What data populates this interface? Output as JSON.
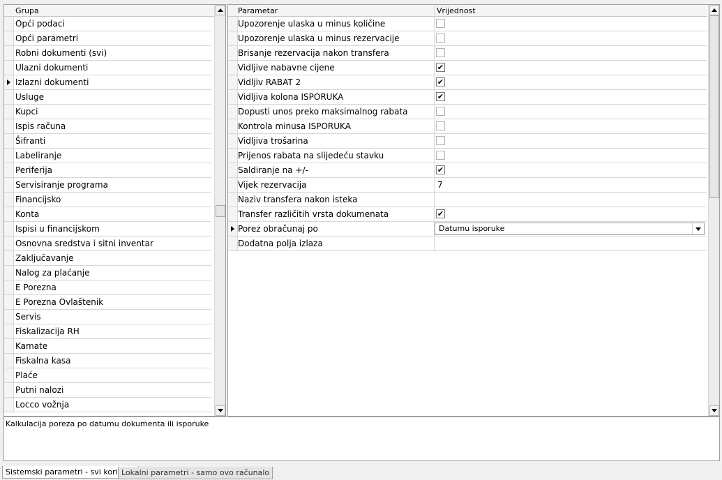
{
  "groups": {
    "header": "Grupa",
    "items": [
      {
        "label": "Opći podaci"
      },
      {
        "label": "Opći parametri"
      },
      {
        "label": "Robni dokumenti (svi)"
      },
      {
        "label": "Ulazni dokumenti"
      },
      {
        "label": "Izlazni dokumenti",
        "selected": true
      },
      {
        "label": "Usluge"
      },
      {
        "label": "Kupci"
      },
      {
        "label": "Ispis računa"
      },
      {
        "label": "Šifranti"
      },
      {
        "label": "Labeliranje"
      },
      {
        "label": "Periferija"
      },
      {
        "label": "Servisiranje programa"
      },
      {
        "label": "Financijsko"
      },
      {
        "label": "Konta"
      },
      {
        "label": "Ispisi u financijskom"
      },
      {
        "label": "Osnovna sredstva i sitni inventar"
      },
      {
        "label": "Zaključavanje"
      },
      {
        "label": "Nalog za plaćanje"
      },
      {
        "label": "E Porezna"
      },
      {
        "label": "E Porezna Ovlaštenik"
      },
      {
        "label": "Servis"
      },
      {
        "label": "Fiskalizacija RH"
      },
      {
        "label": "Kamate"
      },
      {
        "label": "Fiskalna kasa"
      },
      {
        "label": "Plaće"
      },
      {
        "label": "Putni nalozi"
      },
      {
        "label": "Locco vožnja"
      }
    ]
  },
  "params": {
    "header_param": "Parametar",
    "header_value": "Vrijednost",
    "rows": [
      {
        "label": "Upozorenje ulaska u minus količine",
        "type": "checkbox",
        "checked": false
      },
      {
        "label": "Upozorenje ulaska u minus rezervacije",
        "type": "checkbox",
        "checked": false
      },
      {
        "label": "Brisanje rezervacija nakon transfera",
        "type": "checkbox",
        "checked": false
      },
      {
        "label": "Vidljive nabavne cijene",
        "type": "checkbox",
        "checked": true
      },
      {
        "label": "Vidljiv RABAT 2",
        "type": "checkbox",
        "checked": true
      },
      {
        "label": "Vidljiva kolona ISPORUKA",
        "type": "checkbox",
        "checked": true
      },
      {
        "label": "Dopusti unos preko maksimalnog rabata",
        "type": "checkbox",
        "checked": false
      },
      {
        "label": "Kontrola  minusa ISPORUKA",
        "type": "checkbox",
        "checked": false
      },
      {
        "label": "Vidljiva trošarina",
        "type": "checkbox",
        "checked": false
      },
      {
        "label": "Prijenos rabata na slijedeću stavku",
        "type": "checkbox",
        "checked": false
      },
      {
        "label": "Saldiranje na +/-",
        "type": "checkbox",
        "checked": true
      },
      {
        "label": "Vijek rezervacija",
        "type": "text",
        "value": "7"
      },
      {
        "label": "Naziv transfera nakon isteka",
        "type": "text",
        "value": ""
      },
      {
        "label": "Transfer različitih vrsta dokumenata",
        "type": "checkbox",
        "checked": true
      },
      {
        "label": "Porez obračunaj po",
        "type": "dropdown",
        "value": "Datumu isporuke",
        "selected": true
      },
      {
        "label": "Dodatna polja izlaza",
        "type": "text",
        "value": ""
      }
    ]
  },
  "description": "Kalkulacija poreza po datumu dokumenta ili isporuke",
  "tabs": [
    {
      "label": "Sistemski parametri - svi korisnici",
      "active": true
    },
    {
      "label": "Lokalni parametri - samo ovo računalo",
      "active": false
    }
  ],
  "check_glyph": "✔"
}
